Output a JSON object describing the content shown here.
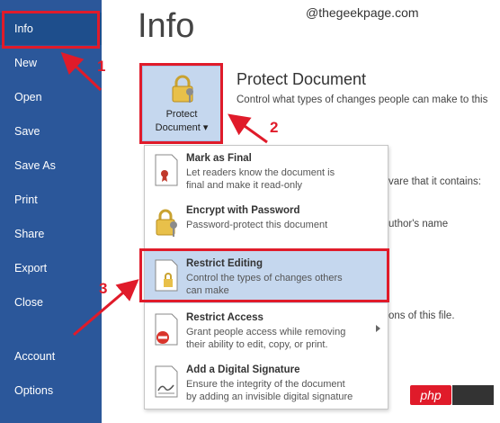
{
  "sidebar": {
    "items": [
      {
        "label": "Info"
      },
      {
        "label": "New"
      },
      {
        "label": "Open"
      },
      {
        "label": "Save"
      },
      {
        "label": "Save As"
      },
      {
        "label": "Print"
      },
      {
        "label": "Share"
      },
      {
        "label": "Export"
      },
      {
        "label": "Close"
      },
      {
        "label": "Account"
      },
      {
        "label": "Options"
      }
    ]
  },
  "main": {
    "title": "Info",
    "watermark": "@thegeekpage.com",
    "protect": {
      "button_line1": "Protect",
      "button_line2": "Document ▾",
      "heading": "Protect Document",
      "description": "Control what types of changes people can make to this"
    },
    "background_text": {
      "line1": "vare that it contains:",
      "line2": "uthor's name",
      "line3": "ons of this file."
    }
  },
  "menu": {
    "items": [
      {
        "title": "Mark as Final",
        "desc": [
          "Let readers know the document is",
          "final and make it read-only"
        ]
      },
      {
        "title": "Encrypt with Password",
        "desc": [
          "Password-protect this document"
        ]
      },
      {
        "title": "Restrict Editing",
        "desc": [
          "Control the types of changes others",
          "can make"
        ]
      },
      {
        "title": "Restrict Access",
        "desc": [
          "Grant people access while removing",
          "their ability to edit, copy, or print."
        ]
      },
      {
        "title": "Add a Digital Signature",
        "desc": [
          "Ensure the integrity of the document",
          "by adding an invisible digital signature"
        ]
      }
    ]
  },
  "callouts": {
    "one": "1",
    "two": "2",
    "three": "3"
  },
  "badge": {
    "text": "php"
  },
  "colors": {
    "sidebar": "#2b579a",
    "highlight": "#e01b2a",
    "hover": "#c5d7ee"
  }
}
